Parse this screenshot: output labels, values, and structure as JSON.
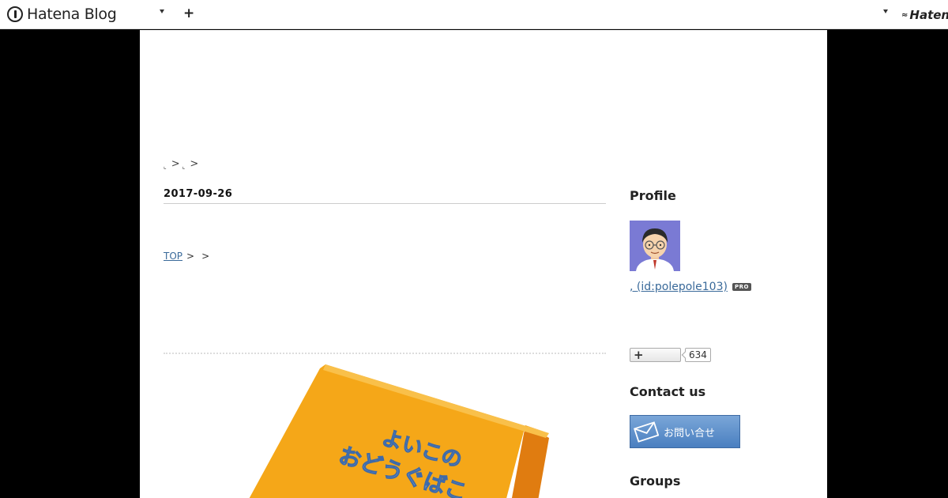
{
  "topbar": {
    "logo_text": "Hatena Blog",
    "plus": "+",
    "right_logo_text": "Hatena"
  },
  "blog": {
    "breadcrumb": {
      "sep1": ">",
      "sep2": ">"
    }
  },
  "entry": {
    "date": "2017-09-26",
    "path": {
      "top_link": "TOP",
      "sep1": ">",
      "sep2": ">"
    }
  },
  "sidebar": {
    "profile_heading": "Profile",
    "profile_id": "(id:polepole103)",
    "pro_badge": "PRO",
    "subscribe_count": "634",
    "contact_heading": "Contact us",
    "contact_button": "お問い合せ",
    "groups_heading": "Groups"
  },
  "eyecatch": {
    "text_line1": "よいこの",
    "text_line2": "おどうぐばこ"
  },
  "colors": {
    "link": "#3a6a9a",
    "box_orange": "#f5a718",
    "avatar_bg": "#7a7ad4",
    "contact_blue": "#4a7fc0"
  }
}
